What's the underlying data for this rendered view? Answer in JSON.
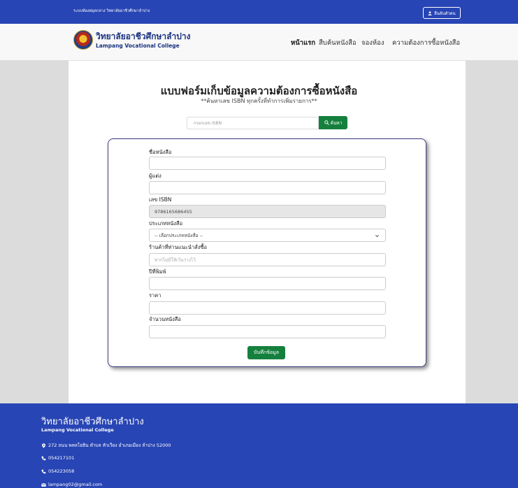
{
  "topbar": {
    "system_name": "ระบบห้องสมุดกลาง วิทยาลัยอาชีวศึกษาลำปาง",
    "user_label": "ยืนยันตัวตน"
  },
  "navbar": {
    "brand_th": "วิทยาลัยอาชีวศึกษาลำปาง",
    "brand_en": "Lampang Vocational College",
    "links": [
      "หน้าแรก",
      "สืบค้นหนังสือ",
      "จองห้อง",
      "ความต้องการซื้อหนังสือ"
    ]
  },
  "page": {
    "title": "แบบฟอร์มเก็บข้อมูลความต้องการซื้อหนังสือ",
    "subtitle": "**ค้นหาเลข ISBN ทุกครั้งที่ทำการเพิ่มรายการ**"
  },
  "search": {
    "placeholder": "กรอกเลข ISBN",
    "button_label": "ค้นหา"
  },
  "form": {
    "book_title_label": "ชื่อหนังสือ",
    "book_title_value": "",
    "author_label": "ผู้แต่ง",
    "author_value": "",
    "isbn_label": "เลข ISBN",
    "isbn_value": "9786165686455",
    "category_label": "ประเภทหนังสือ",
    "category_value": "-- เลือกประเภทหนังสือ --",
    "store_label": "ร้านค้าที่ท่านแนะนำสั่งซื้อ",
    "store_placeholder": "หากไม่มีให้เว้นว่างไว้",
    "year_label": "ปีที่พิมพ์",
    "year_value": "",
    "price_label": "ราคา",
    "price_value": "",
    "quantity_label": "จำนวนหนังสือ",
    "quantity_value": "",
    "save_label": "บันทึกข้อมูล"
  },
  "footer": {
    "title": "วิทยาลัยอาชีวศึกษาลำปาง",
    "subtitle": "Lampang Vocational College",
    "address": "272 ถนน พหลโยธิน ตำบล หัวเวียง อำเภอเมือง ลำปาง 52000",
    "phone1": "054217101",
    "phone2": "054223058",
    "email": "lampang02@gmail.com"
  },
  "colors": {
    "brand_blue": "#2845b5",
    "button_green": "#15803d",
    "form_border": "#3c3c82"
  },
  "icons": [
    "user-icon",
    "search-icon",
    "chevron-down-icon",
    "map-marker-icon",
    "phone-icon",
    "envelope-icon"
  ]
}
